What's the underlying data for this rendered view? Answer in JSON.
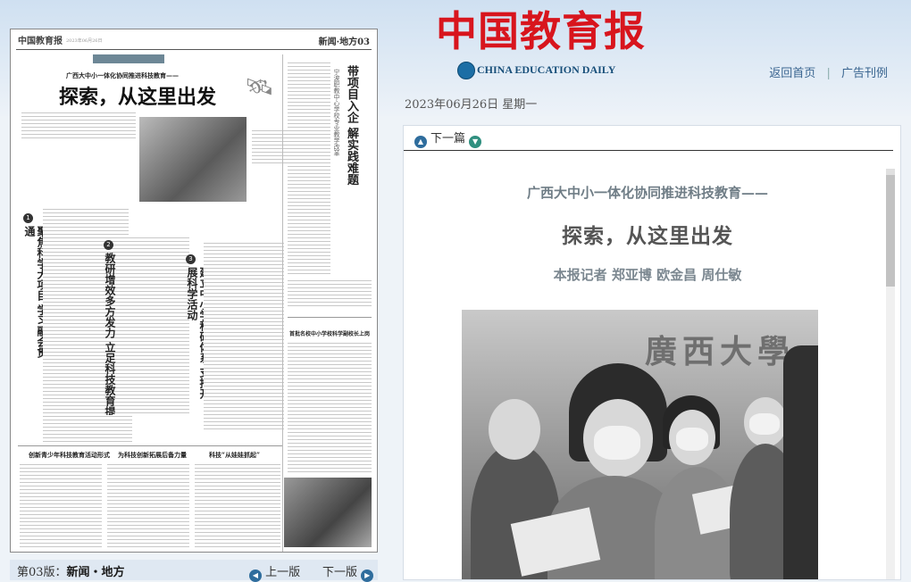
{
  "header": {
    "logo_text": "中国教育报",
    "sublogo_text": "CHINA EDUCATION DAILY",
    "nav": {
      "home": "返回首页",
      "sep": "|",
      "ads": "广告刊例"
    },
    "date": "2023年06月26日  星期一"
  },
  "paper": {
    "masthead": "中国教育报",
    "masthead_date": "2023年06月26日",
    "section": "新闻·地方03",
    "kicker": "广西大中小一体化协同推进科技教育——",
    "title": "探索，从这里出发",
    "headline_1": "聚焦科学大项目 学习融会贯通",
    "headline_2": "教研增效多方发力 立足科技教育提质",
    "headline_3": "建立中小学科研体系 支持开展科学活动",
    "side_headline": "带项目入企 解实践难题",
    "side_sub": "宁波职教中心学校专业教学改革",
    "bottom_h1": "创新青少年科技教育活动形式",
    "bottom_h2": "为科技创新拓展后备力量",
    "bottom_h3": "科技“从娃娃抓起”",
    "side_small": "首批名校中小学校科学副校长上岗"
  },
  "pagebar": {
    "label_prefix": "第03版：",
    "label_section": "新闻・地方",
    "prev": "上一版",
    "next": "下一版"
  },
  "viewer": {
    "prev_article": "下一篇",
    "kicker": "广西大中小一体化协同推进科技教育——",
    "title": "探索，从这里出发",
    "byline": "本报记者  郑亚博  欧金昌  周仕敏",
    "photo_sign": "廣西大學"
  },
  "icons": {
    "prev_page": "arrow-left-icon",
    "next_page": "arrow-right-icon",
    "prev_article": "up-circle-icon",
    "next_article": "down-circle-icon",
    "logo_badge": "globe-icon"
  },
  "colors": {
    "logo": "#d8151d",
    "nav_link": "#3a6590",
    "badge": "#2f6d9d"
  }
}
